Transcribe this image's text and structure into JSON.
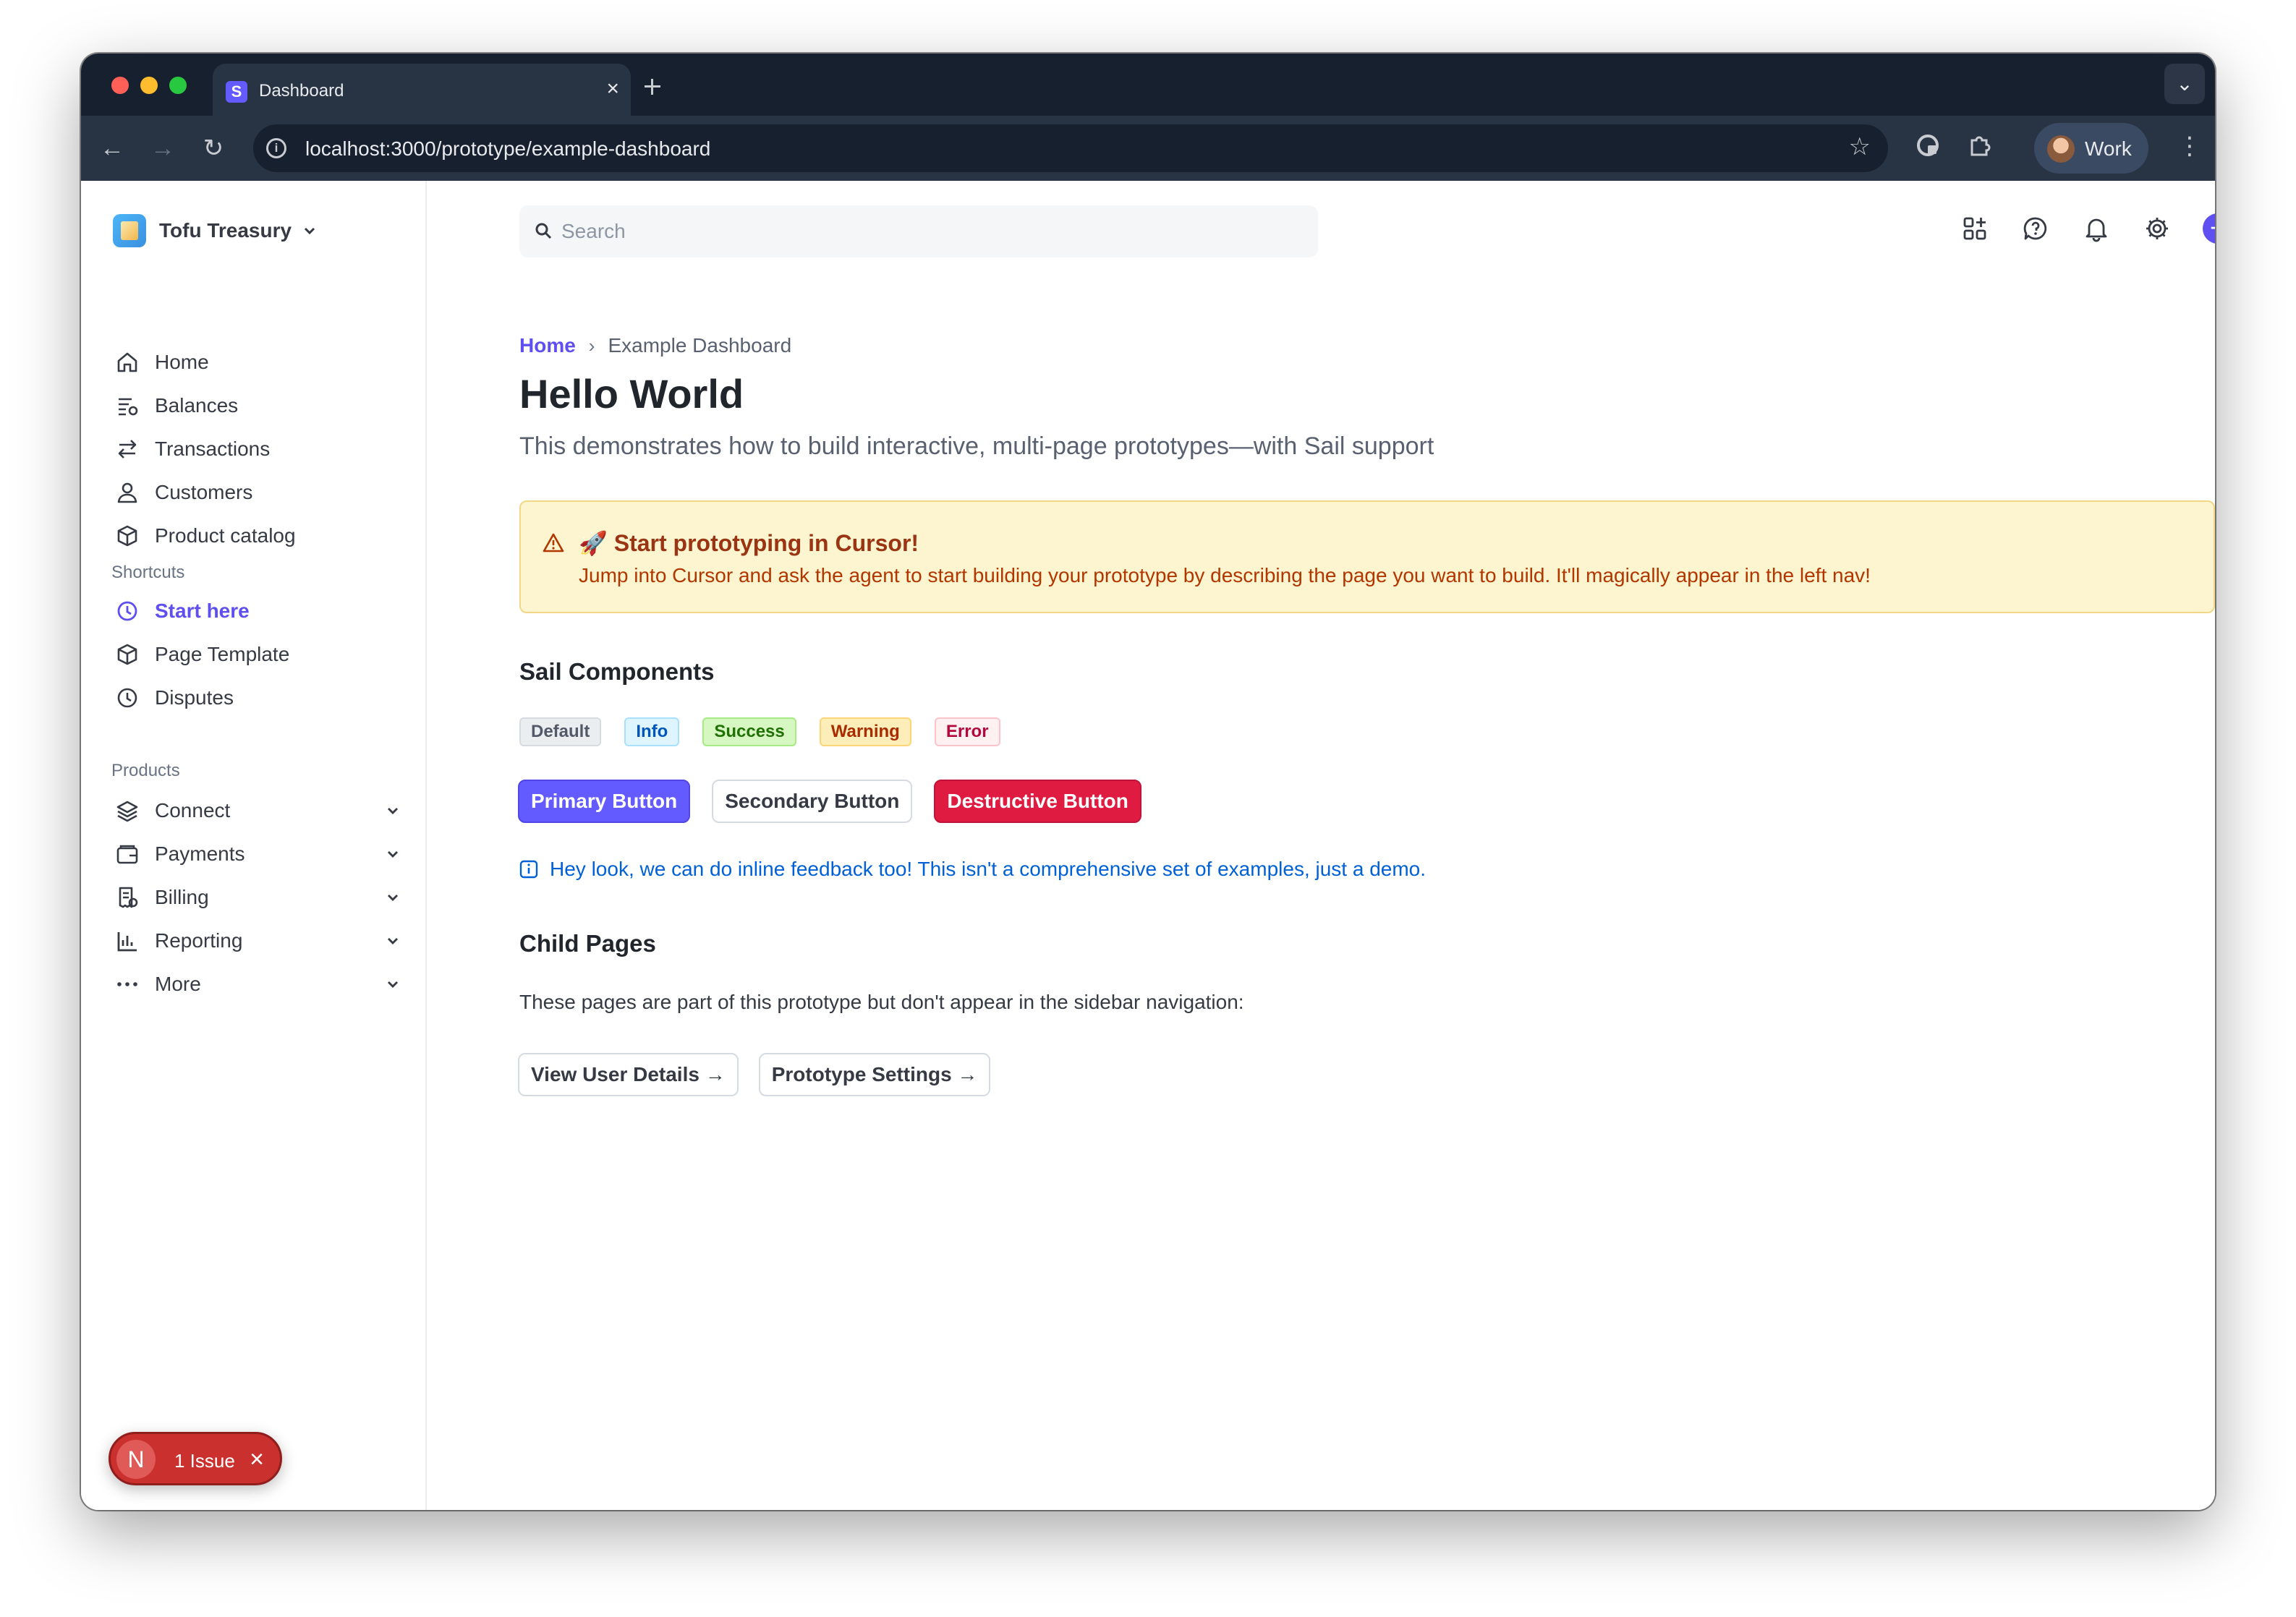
{
  "browser": {
    "tab_title": "Dashboard",
    "tab_favicon": "S",
    "url": "localhost:3000/prototype/example-dashboard",
    "profile_label": "Work"
  },
  "sidebar": {
    "account_name": "Tofu Treasury",
    "main_items": [
      {
        "label": "Home",
        "icon": "home-icon"
      },
      {
        "label": "Balances",
        "icon": "balances-icon"
      },
      {
        "label": "Transactions",
        "icon": "transactions-icon"
      },
      {
        "label": "Customers",
        "icon": "customer-icon"
      },
      {
        "label": "Product catalog",
        "icon": "box-icon"
      }
    ],
    "shortcuts_title": "Shortcuts",
    "shortcuts": [
      {
        "label": "Start here",
        "icon": "clock-icon",
        "active": true
      },
      {
        "label": "Page Template",
        "icon": "box-icon"
      },
      {
        "label": "Disputes",
        "icon": "clock-icon"
      }
    ],
    "products_title": "Products",
    "products": [
      {
        "label": "Connect",
        "icon": "layers-icon"
      },
      {
        "label": "Payments",
        "icon": "wallet-icon"
      },
      {
        "label": "Billing",
        "icon": "billing-icon"
      },
      {
        "label": "Reporting",
        "icon": "chart-icon"
      },
      {
        "label": "More",
        "icon": "more-icon"
      }
    ],
    "issue": {
      "avatar": "N",
      "label": "1 Issue"
    }
  },
  "header": {
    "search_placeholder": "Search"
  },
  "breadcrumb": {
    "home": "Home",
    "current": "Example Dashboard"
  },
  "page": {
    "title": "Hello World",
    "subtitle": "This demonstrates how to build interactive, multi-page prototypes—with Sail support"
  },
  "banner": {
    "title": "🚀 Start prototyping in Cursor!",
    "body": "Jump into Cursor and ask the agent to start building your prototype by describing the page you want to build. It'll magically appear in the left nav!"
  },
  "components": {
    "heading": "Sail Components",
    "badges": [
      "Default",
      "Info",
      "Success",
      "Warning",
      "Error"
    ],
    "buttons": {
      "primary": "Primary Button",
      "secondary": "Secondary Button",
      "destructive": "Destructive Button"
    },
    "inline_feedback": "Hey look, we can do inline feedback too! This isn't a comprehensive set of examples, just a demo."
  },
  "child_pages": {
    "heading": "Child Pages",
    "description": "These pages are part of this prototype but don't appear in the sidebar navigation:",
    "links": [
      "View User Details →",
      "Prototype Settings →"
    ]
  },
  "colors": {
    "accent": "#635bff",
    "destructive": "#df1b41",
    "chrome_dark": "#17202e"
  }
}
